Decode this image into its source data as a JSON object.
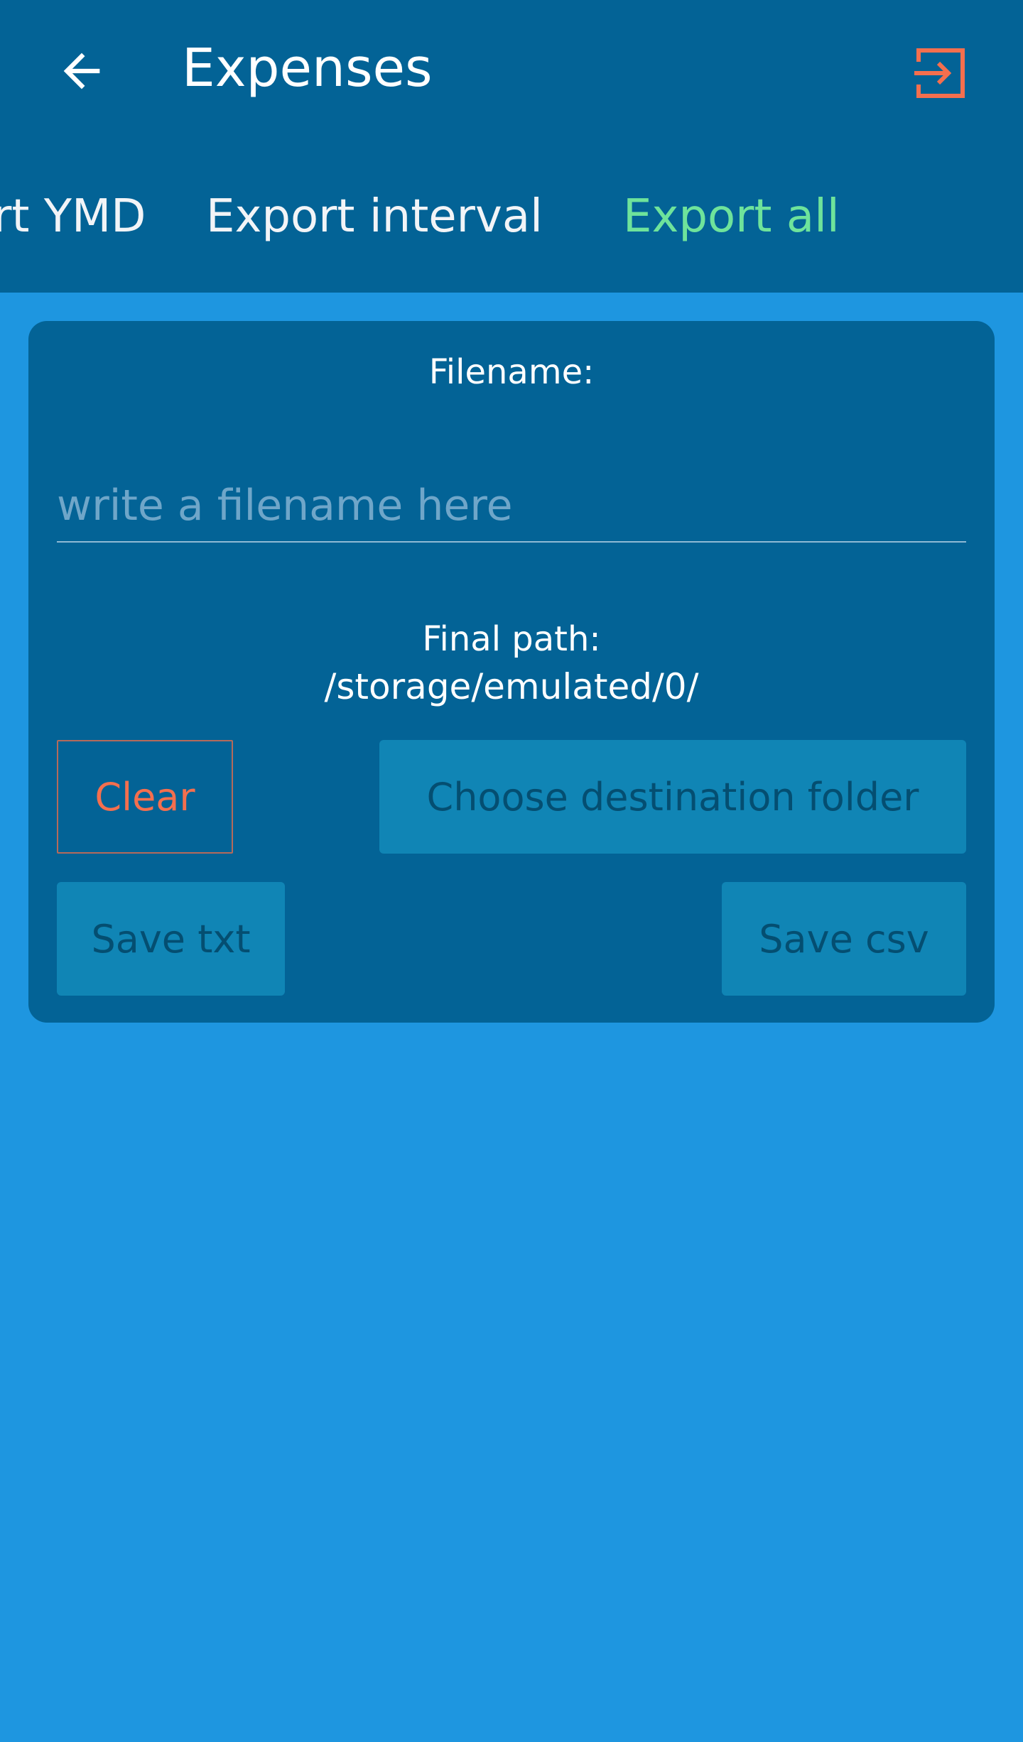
{
  "appbar": {
    "title": "Expenses",
    "back_icon": "arrow-left-icon",
    "export_icon": "login-arrow-icon"
  },
  "tabs": [
    {
      "label": "Export YMD",
      "active": false
    },
    {
      "label": "Export interval",
      "active": false
    },
    {
      "label": "Export all",
      "active": true
    }
  ],
  "form": {
    "filename_label": "Filename:",
    "filename_value": "",
    "filename_placeholder": "write a filename here",
    "final_path_label": "Final path:",
    "final_path_value": "/storage/emulated/0/"
  },
  "buttons": {
    "clear": "Clear",
    "choose_folder": "Choose destination folder",
    "save_txt": "Save txt",
    "save_csv": "Save csv"
  },
  "colors": {
    "background": "#1e96e0",
    "bar": "#036396",
    "active_tab": "#6ee39b",
    "accent_orange": "#f46f4e",
    "disabled_button": "#1085b5"
  }
}
